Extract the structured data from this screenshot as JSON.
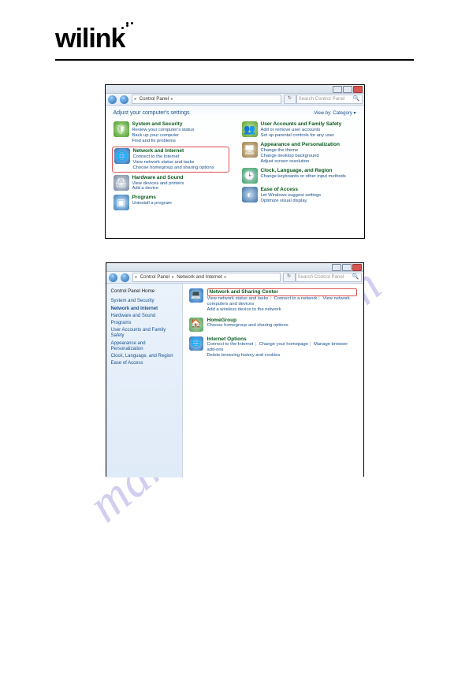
{
  "logo_text": "wilink",
  "watermark": "manualshive.com",
  "shot1": {
    "breadcrumb": [
      "Control Panel"
    ],
    "searchbox_placeholder": "Search Control Panel",
    "heading": "Adjust your computer's settings",
    "viewby": "View by: Category ▾",
    "left": [
      {
        "name": "System and Security",
        "subs": [
          "Review your computer's status",
          "Back up your computer",
          "Find and fix problems"
        ]
      },
      {
        "name": "Network and Internet",
        "subs": [
          "Connect to the Internet",
          "View network status and tasks",
          "Choose homegroup and sharing options"
        ],
        "highlight": true
      },
      {
        "name": "Hardware and Sound",
        "subs": [
          "View devices and printers",
          "Add a device"
        ]
      },
      {
        "name": "Programs",
        "subs": [
          "Uninstall a program"
        ]
      }
    ],
    "right": [
      {
        "name": "User Accounts and Family Safety",
        "subs": [
          "Add or remove user accounts",
          "Set up parental controls for any user"
        ]
      },
      {
        "name": "Appearance and Personalization",
        "subs": [
          "Change the theme",
          "Change desktop background",
          "Adjust screen resolution"
        ]
      },
      {
        "name": "Clock, Language, and Region",
        "subs": [
          "Change keyboards or other input methods"
        ]
      },
      {
        "name": "Ease of Access",
        "subs": [
          "Let Windows suggest settings",
          "Optimize visual display"
        ]
      }
    ]
  },
  "shot2": {
    "breadcrumb": [
      "Control Panel",
      "Network and Internet"
    ],
    "searchbox_placeholder": "Search Control Panel",
    "side_heading": "Control Panel Home",
    "side_items": [
      {
        "label": "System and Security"
      },
      {
        "label": "Network and Internet",
        "bold": true
      },
      {
        "label": "Hardware and Sound"
      },
      {
        "label": "Programs"
      },
      {
        "label": "User Accounts and Family Safety"
      },
      {
        "label": "Appearance and Personalization"
      },
      {
        "label": "Clock, Language, and Region"
      },
      {
        "label": "Ease of Access"
      }
    ],
    "entries": [
      {
        "name": "Network and Sharing Center",
        "highlight": true,
        "links": [
          "View network status and tasks",
          "Connect to a network",
          "View network computers and devices",
          "Add a wireless device to the network"
        ]
      },
      {
        "name": "HomeGroup",
        "links": [
          "Choose homegroup and sharing options"
        ]
      },
      {
        "name": "Internet Options",
        "links": [
          "Connect to the Internet",
          "Change your homepage",
          "Manage browser add-ons",
          "Delete browsing history and cookies"
        ]
      }
    ]
  }
}
